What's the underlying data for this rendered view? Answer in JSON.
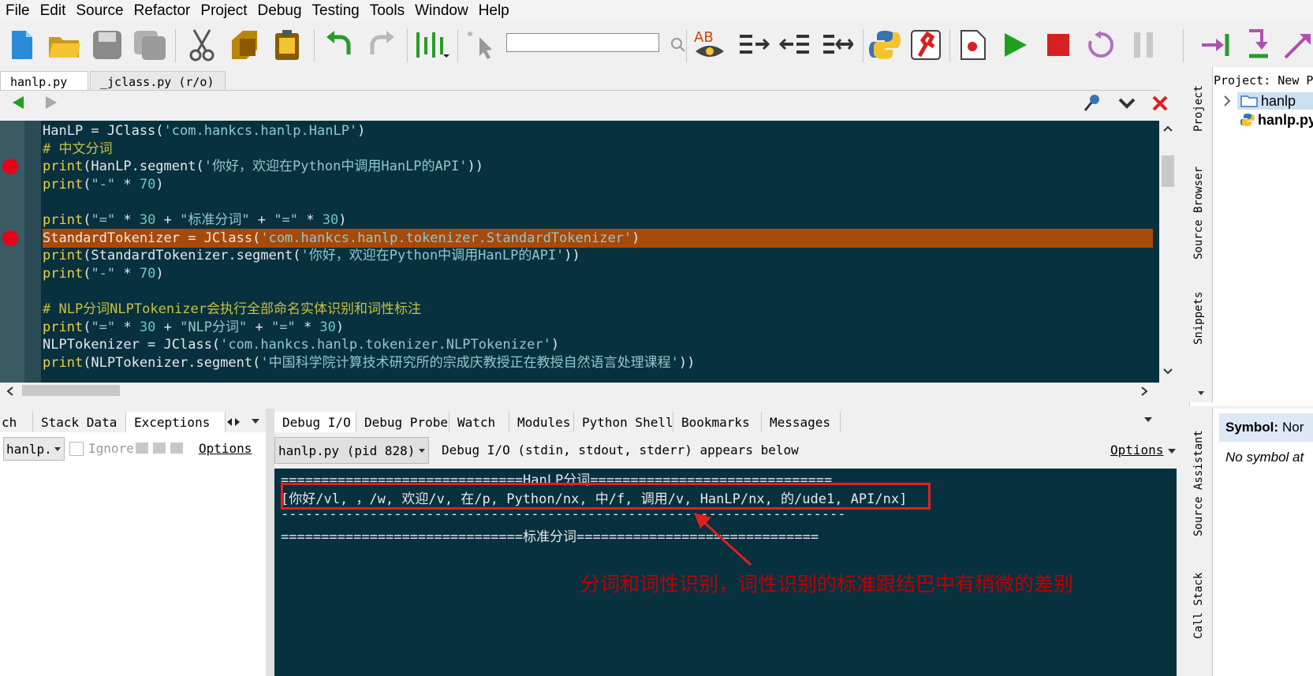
{
  "menu": [
    "File",
    "Edit",
    "Source",
    "Refactor",
    "Project",
    "Debug",
    "Testing",
    "Tools",
    "Window",
    "Help"
  ],
  "editor_tabs": [
    {
      "label": "hanlp.py",
      "active": true
    },
    {
      "label": "_jclass.py (r/o)",
      "active": false
    }
  ],
  "code_lines": [
    {
      "parts": [
        [
          "op",
          "HanLP = JClass("
        ],
        [
          "str",
          "'com.hankcs.hanlp.HanLP'"
        ],
        [
          "op",
          ")"
        ]
      ]
    },
    {
      "parts": [
        [
          "cm",
          "# 中文分词"
        ]
      ]
    },
    {
      "parts": [
        [
          "kw",
          "print"
        ],
        [
          "op",
          "(HanLP.segment("
        ],
        [
          "str",
          "'你好，欢迎在Python中调用HanLP的API'"
        ],
        [
          "op",
          "))"
        ]
      ],
      "bp": true
    },
    {
      "parts": [
        [
          "kw",
          "print"
        ],
        [
          "op",
          "("
        ],
        [
          "str",
          "\"-\""
        ],
        [
          "op",
          " * "
        ],
        [
          "num",
          "70"
        ],
        [
          "op",
          ")"
        ]
      ]
    },
    {
      "parts": []
    },
    {
      "parts": [
        [
          "kw",
          "print"
        ],
        [
          "op",
          "("
        ],
        [
          "str",
          "\"=\""
        ],
        [
          "op",
          " * "
        ],
        [
          "num",
          "30"
        ],
        [
          "op",
          " + "
        ],
        [
          "str",
          "\"标准分词\""
        ],
        [
          "op",
          " + "
        ],
        [
          "str",
          "\"=\""
        ],
        [
          "op",
          " * "
        ],
        [
          "num",
          "30"
        ],
        [
          "op",
          ")"
        ]
      ]
    },
    {
      "parts": [
        [
          "op",
          "StandardTokenizer = JClass("
        ],
        [
          "str",
          "'com.hankcs.hanlp.tokenizer.StandardTokenizer'"
        ],
        [
          "op",
          ")"
        ]
      ],
      "bp": true,
      "hl": true
    },
    {
      "parts": [
        [
          "kw",
          "print"
        ],
        [
          "op",
          "(StandardTokenizer.segment("
        ],
        [
          "str",
          "'你好，欢迎在Python中调用HanLP的API'"
        ],
        [
          "op",
          "))"
        ]
      ]
    },
    {
      "parts": [
        [
          "kw",
          "print"
        ],
        [
          "op",
          "("
        ],
        [
          "str",
          "\"-\""
        ],
        [
          "op",
          " * "
        ],
        [
          "num",
          "70"
        ],
        [
          "op",
          ")"
        ]
      ]
    },
    {
      "parts": []
    },
    {
      "parts": [
        [
          "cm",
          "# NLP分词NLPTokenizer会执行全部命名实体识别和词性标注"
        ]
      ]
    },
    {
      "parts": [
        [
          "kw",
          "print"
        ],
        [
          "op",
          "("
        ],
        [
          "str",
          "\"=\""
        ],
        [
          "op",
          " * "
        ],
        [
          "num",
          "30"
        ],
        [
          "op",
          " + "
        ],
        [
          "str",
          "\"NLP分词\""
        ],
        [
          "op",
          " + "
        ],
        [
          "str",
          "\"=\""
        ],
        [
          "op",
          " * "
        ],
        [
          "num",
          "30"
        ],
        [
          "op",
          ")"
        ]
      ]
    },
    {
      "parts": [
        [
          "op",
          "NLPTokenizer = JClass("
        ],
        [
          "str",
          "'com.hankcs.hanlp.tokenizer.NLPTokenizer'"
        ],
        [
          "op",
          ")"
        ]
      ]
    },
    {
      "parts": [
        [
          "kw",
          "print"
        ],
        [
          "op",
          "(NLPTokenizer.segment("
        ],
        [
          "str",
          "'中国科学院计算技术研究所的宗成庆教授正在教授自然语言处理课程'"
        ],
        [
          "op",
          "))"
        ]
      ]
    }
  ],
  "right_panel": {
    "project_label": "Project: New P",
    "tree": [
      {
        "label": "hanlp",
        "type": "folder"
      },
      {
        "label": "hanlp.py",
        "type": "py"
      }
    ]
  },
  "right_vtabs": [
    "Project",
    "Source Browser",
    "Snippets"
  ],
  "bottom_left_tabs": [
    "ch",
    "Stack Data",
    "Exceptions"
  ],
  "bottom_left_controls": {
    "dropdown": "hanlp.",
    "ignore": "Ignore",
    "options": "Options"
  },
  "bottom_tabs": [
    "Debug I/O",
    "Debug Probe",
    "Watch",
    "Modules",
    "Python Shell",
    "Bookmarks",
    "Messages"
  ],
  "debug_io": {
    "process": "hanlp.py (pid 828)",
    "info": "Debug I/O (stdin, stdout, stderr) appears below",
    "options": "Options",
    "lines": [
      "==============================HanLP分词==============================",
      "[你好/vl, ，/w, 欢迎/v, 在/p, Python/nx, 中/f, 调用/v, HanLP/nx, 的/ude1, API/nx]",
      "----------------------------------------------------------------------",
      "==============================标准分词=============================="
    ],
    "annotation": "分词和词性识别，词性识别的标准跟结巴中有稍微的差别"
  },
  "source_assistant": {
    "symbol_label": "Symbol:",
    "symbol_value": "Nor",
    "no_symbol": "No symbol at"
  },
  "bottom_right_vtabs": [
    "Source Assistant",
    "Call Stack"
  ],
  "colors": {
    "editor_bg": "#08313f",
    "highlight": "#a64a0c",
    "breakpoint": "#e8001a",
    "annotation": "#c00000"
  }
}
